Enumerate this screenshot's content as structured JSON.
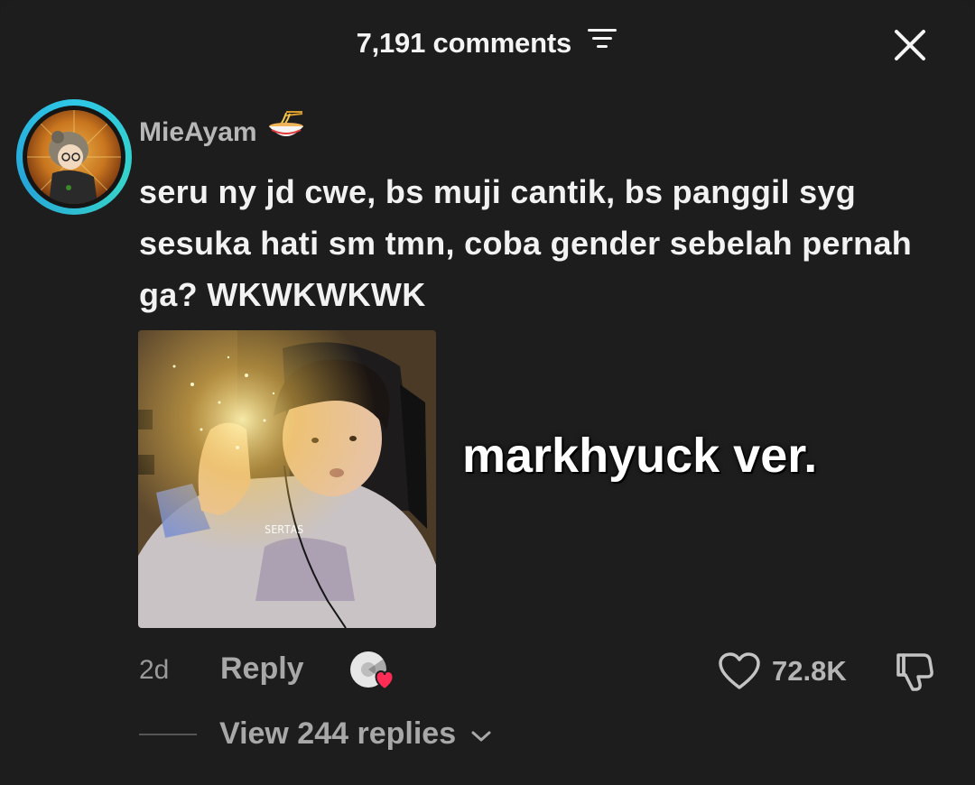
{
  "header": {
    "comment_count": "7,191 comments",
    "filter_icon": "filter-sort-icon",
    "close_icon": "close-icon"
  },
  "comment": {
    "username": "MieAyam",
    "username_emoji_icon": "noodle-bowl-icon",
    "text": "seru ny jd cwe, bs muji cantik, bs panggil syg sesuka hati sm tmn, coba gender sebelah pernah ga? WKWKWKWK",
    "image_watermark": "SERTAS",
    "image_caption": "markhyuck ver.",
    "time_ago": "2d",
    "reply_label": "Reply",
    "likes": "72.8K",
    "view_replies_label": "View 244 replies"
  },
  "colors": {
    "background": "#1d1d1d",
    "avatar_ring": "#2ec7e6",
    "creator_heart": "#ff2d55",
    "muted_text": "#a8a8a8"
  }
}
